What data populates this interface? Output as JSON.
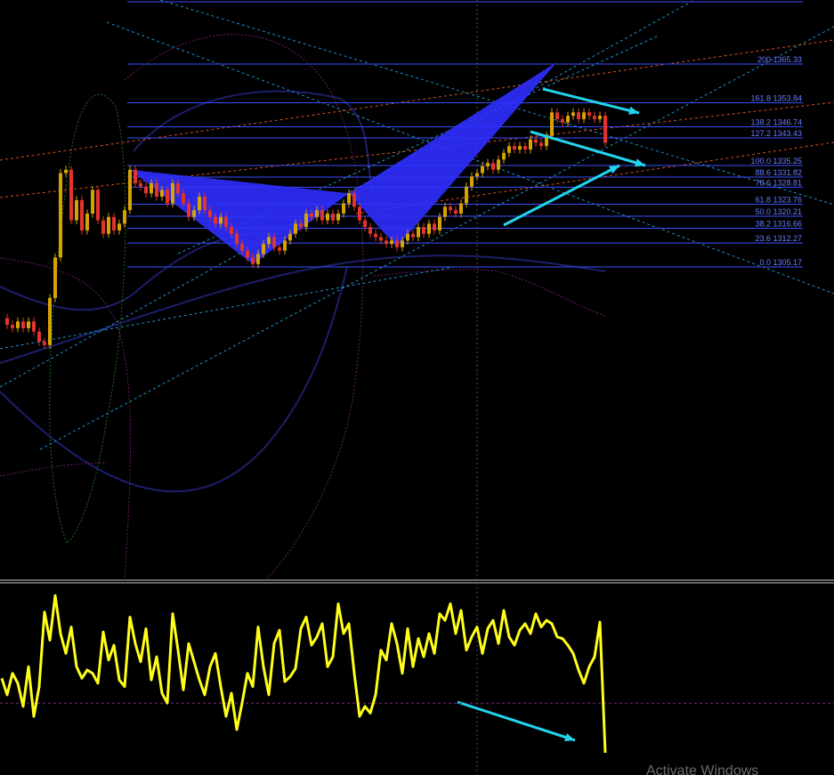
{
  "colors": {
    "background": "#000000",
    "bull_candle": "#d7a300",
    "bear_candle": "#e5322b",
    "fib_line": "#3a4fff",
    "fib_text": "#6a7cff",
    "pattern_fill": "#2f2fff",
    "arrow": "#21d5ee",
    "oscillator": "#ffff1a",
    "band": "#1d1f6b",
    "envelope": "#6b1e6b",
    "channel": "#1f8fcf",
    "trend": "#d2541a",
    "green_channel": "#1f6b1f",
    "panel_separator": "#c8c8c8",
    "crosshair": "#555555",
    "osc_level": "#7a2a7a"
  },
  "watermark": {
    "text": "Activate Windows"
  },
  "chart_data": [
    {
      "type": "candlestick",
      "panel": "price",
      "title": "",
      "xlabel": "",
      "ylabel": "",
      "ylim": [
        1268,
        1375
      ],
      "grid": false,
      "fibonacci_levels": [
        {
          "ratio": "200",
          "price": "1365.33",
          "value": 1365.33
        },
        {
          "ratio": "161.8",
          "price": "1353.84",
          "value": 1353.84
        },
        {
          "ratio": "138.2",
          "price": "1346.74",
          "value": 1346.74
        },
        {
          "ratio": "127.2",
          "price": "1343.43",
          "value": 1343.43
        },
        {
          "ratio": "100.0",
          "price": "1335.25",
          "value": 1335.25
        },
        {
          "ratio": "88.6",
          "price": "1331.82",
          "value": 1331.82
        },
        {
          "ratio": "78.6",
          "price": "1328.81",
          "value": 1328.81
        },
        {
          "ratio": "61.8",
          "price": "1323.76",
          "value": 1323.76
        },
        {
          "ratio": "50.0",
          "price": "1320.21",
          "value": 1320.21
        },
        {
          "ratio": "38.2",
          "price": "1316.66",
          "value": 1316.66
        },
        {
          "ratio": "23.6",
          "price": "1312.27",
          "value": 1312.27
        },
        {
          "ratio": "0.0",
          "price": "1305.17",
          "value": 1305.17
        }
      ],
      "price_path": [
        [
          0,
          1290
        ],
        [
          6,
          1288
        ],
        [
          12,
          1287
        ],
        [
          18,
          1289
        ],
        [
          24,
          1287
        ],
        [
          30,
          1289
        ],
        [
          36,
          1286
        ],
        [
          42,
          1283
        ],
        [
          48,
          1282
        ],
        [
          54,
          1296
        ],
        [
          60,
          1308
        ],
        [
          66,
          1333
        ],
        [
          72,
          1334
        ],
        [
          78,
          1319
        ],
        [
          84,
          1325
        ],
        [
          90,
          1316
        ],
        [
          96,
          1321
        ],
        [
          102,
          1328
        ],
        [
          108,
          1319
        ],
        [
          114,
          1315
        ],
        [
          120,
          1320
        ],
        [
          126,
          1316
        ],
        [
          132,
          1318
        ],
        [
          138,
          1322
        ],
        [
          144,
          1334
        ],
        [
          150,
          1330
        ],
        [
          156,
          1329
        ],
        [
          162,
          1327
        ],
        [
          168,
          1330
        ],
        [
          174,
          1326
        ],
        [
          180,
          1328
        ],
        [
          186,
          1324
        ],
        [
          192,
          1330
        ],
        [
          198,
          1327
        ],
        [
          204,
          1324
        ],
        [
          210,
          1320
        ],
        [
          216,
          1322
        ],
        [
          222,
          1326
        ],
        [
          228,
          1322
        ],
        [
          234,
          1320
        ],
        [
          240,
          1318
        ],
        [
          246,
          1320
        ],
        [
          252,
          1317
        ],
        [
          258,
          1315
        ],
        [
          264,
          1312
        ],
        [
          270,
          1310
        ],
        [
          276,
          1308
        ],
        [
          282,
          1306
        ],
        [
          288,
          1309
        ],
        [
          294,
          1312
        ],
        [
          300,
          1314
        ],
        [
          306,
          1311
        ],
        [
          312,
          1310
        ],
        [
          318,
          1313
        ],
        [
          324,
          1315
        ],
        [
          330,
          1318
        ],
        [
          336,
          1317
        ],
        [
          342,
          1321
        ],
        [
          348,
          1320
        ],
        [
          354,
          1322
        ],
        [
          360,
          1319
        ],
        [
          366,
          1321
        ],
        [
          372,
          1319
        ],
        [
          378,
          1321
        ],
        [
          384,
          1324
        ],
        [
          390,
          1327
        ],
        [
          396,
          1323
        ],
        [
          402,
          1319
        ],
        [
          408,
          1317
        ],
        [
          414,
          1315
        ],
        [
          420,
          1314
        ],
        [
          426,
          1313
        ],
        [
          432,
          1312
        ],
        [
          438,
          1313
        ],
        [
          444,
          1311
        ],
        [
          450,
          1313
        ],
        [
          456,
          1315
        ],
        [
          462,
          1314
        ],
        [
          468,
          1317
        ],
        [
          474,
          1315
        ],
        [
          480,
          1318
        ],
        [
          486,
          1316
        ],
        [
          492,
          1320
        ],
        [
          498,
          1323
        ],
        [
          504,
          1322
        ],
        [
          510,
          1321
        ],
        [
          516,
          1324
        ],
        [
          522,
          1329
        ],
        [
          528,
          1332
        ],
        [
          534,
          1333
        ],
        [
          540,
          1335
        ],
        [
          546,
          1336
        ],
        [
          552,
          1334
        ],
        [
          558,
          1337
        ],
        [
          564,
          1339
        ],
        [
          570,
          1341
        ],
        [
          576,
          1340
        ],
        [
          582,
          1341
        ],
        [
          588,
          1340
        ],
        [
          594,
          1343
        ],
        [
          600,
          1342
        ],
        [
          606,
          1341
        ],
        [
          612,
          1344
        ],
        [
          618,
          1351
        ],
        [
          624,
          1349
        ],
        [
          630,
          1348
        ],
        [
          636,
          1350
        ],
        [
          642,
          1351
        ],
        [
          648,
          1349
        ],
        [
          654,
          1351
        ],
        [
          660,
          1350
        ],
        [
          666,
          1349
        ],
        [
          672,
          1350
        ],
        [
          678,
          1342
        ]
      ]
    },
    {
      "type": "line",
      "panel": "oscillator",
      "title": "",
      "xlabel": "",
      "ylabel": "",
      "ylim": [
        0,
        100
      ],
      "level": 30,
      "series": [
        {
          "x": [
            0,
            6,
            12,
            18,
            24,
            30,
            36,
            42,
            48,
            54,
            60,
            66,
            72,
            78,
            84,
            90,
            96,
            102,
            108,
            114,
            120,
            126,
            132,
            138,
            144,
            150,
            156,
            162,
            168,
            174,
            180,
            186,
            192,
            198,
            204,
            210,
            216,
            222,
            228,
            234,
            240,
            246,
            252,
            258,
            264,
            270,
            276,
            282,
            288,
            294,
            300,
            306,
            312,
            318,
            324,
            330,
            336,
            342,
            348,
            354,
            360,
            366,
            372,
            378,
            384,
            390,
            396,
            402,
            408,
            414,
            420,
            426,
            432,
            438,
            444,
            450,
            456,
            462,
            468,
            474,
            480,
            486,
            492,
            498,
            504,
            510,
            516,
            522,
            528,
            534,
            540,
            546,
            552,
            558,
            564,
            570,
            576,
            582,
            588,
            594,
            600,
            606,
            612,
            618,
            624,
            630,
            636,
            642,
            648,
            654,
            660,
            666,
            672,
            678
          ],
          "values": [
            45,
            35,
            48,
            42,
            28,
            52,
            22,
            40,
            85,
            68,
            95,
            72,
            60,
            76,
            52,
            45,
            50,
            48,
            42,
            73,
            56,
            65,
            44,
            40,
            82,
            66,
            55,
            75,
            44,
            58,
            36,
            30,
            84,
            62,
            38,
            66,
            55,
            44,
            35,
            52,
            60,
            40,
            22,
            36,
            14,
            30,
            48,
            40,
            76,
            52,
            35,
            66,
            74,
            43,
            46,
            51,
            75,
            82,
            65,
            70,
            78,
            52,
            58,
            90,
            72,
            78,
            48,
            22,
            28,
            24,
            35,
            62,
            56,
            78,
            66,
            48,
            75,
            52,
            69,
            58,
            72,
            60,
            84,
            80,
            90,
            72,
            86,
            62,
            70,
            76,
            60,
            75,
            80,
            66,
            86,
            70,
            65,
            74,
            78,
            72,
            84,
            76,
            80,
            78,
            70,
            69,
            65,
            60,
            50,
            42,
            52,
            58,
            79,
            0
          ]
        }
      ]
    }
  ]
}
